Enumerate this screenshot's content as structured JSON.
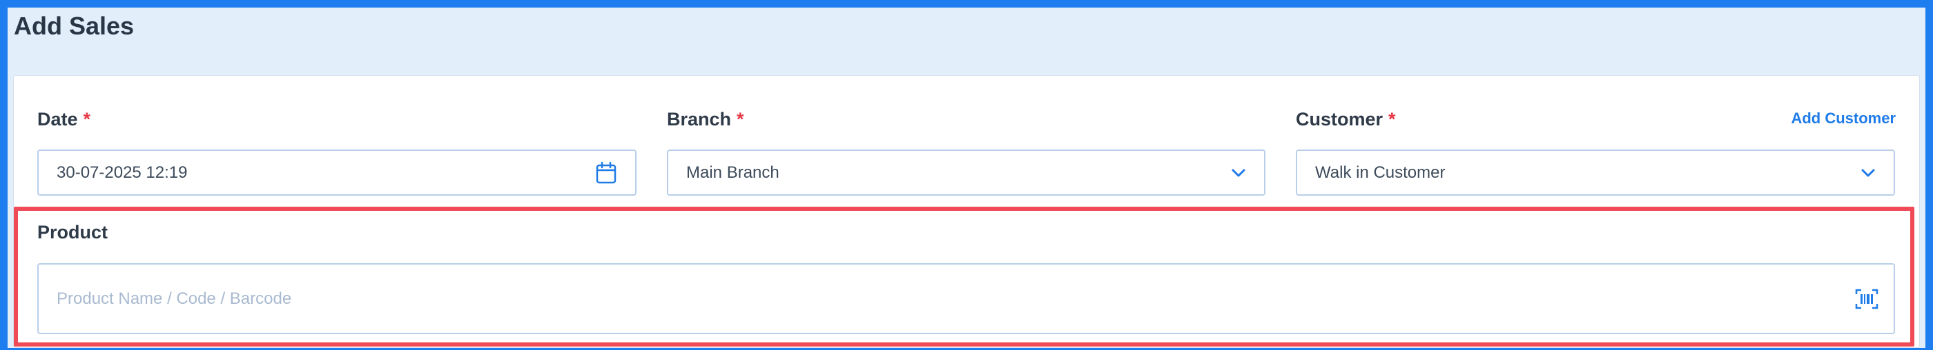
{
  "page": {
    "title": "Add Sales"
  },
  "form": {
    "date": {
      "label": "Date",
      "required_mark": "*",
      "value": "30-07-2025 12:19"
    },
    "branch": {
      "label": "Branch",
      "required_mark": "*",
      "value": "Main Branch"
    },
    "customer": {
      "label": "Customer",
      "required_mark": "*",
      "value": "Walk in Customer",
      "add_link": "Add Customer"
    },
    "product": {
      "label": "Product",
      "placeholder": "Product Name / Code / Barcode",
      "value": ""
    }
  },
  "icons": {
    "date": "calendar-icon",
    "branch": "chevron-down-icon",
    "customer": "chevron-down-icon",
    "product": "barcode-scan-icon"
  },
  "colors": {
    "accent": "#1f7be8",
    "required": "#e53946",
    "highlight": "#ef4a56",
    "header_bg": "#e3eefb",
    "outer_frame": "#1e7ef0"
  }
}
